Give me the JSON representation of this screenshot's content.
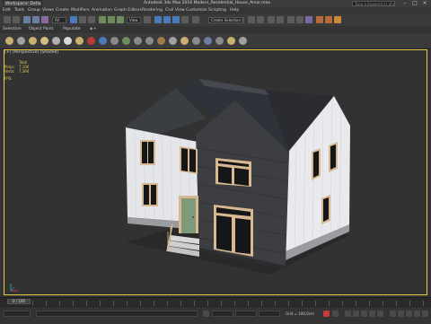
{
  "window": {
    "workspace": "Workspace: Default",
    "title": "Autodesk 3ds Max 2016     Modern_Residential_House_Amar.max",
    "search_placeholder": "Type a keyword or phrase"
  },
  "menu": [
    "Edit",
    "Tools",
    "Group",
    "Views",
    "Create",
    "Modifiers",
    "Animation",
    "Graph Editors",
    "Rendering",
    "Civil View",
    "Customize",
    "Scripting",
    "Help"
  ],
  "toolbar": {
    "selection_filter": "All",
    "view_dropdown": "View",
    "selection_set": "Create Selection Se"
  },
  "ribbon": [
    "Selection",
    "Object Paint",
    "Populate"
  ],
  "viewport": {
    "label": "[+] [Perspective] [Shaded]",
    "stats": {
      "header": "Total",
      "polys_label": "Polys:",
      "polys_value": "7,106",
      "verts_label": "Verts:",
      "verts_value": "7,390",
      "fps_label": "FPS:"
    }
  },
  "timeline": {
    "frame": "0 / 100"
  },
  "status": {
    "grid": "Grid = 100,0cm"
  },
  "colors": {
    "accent": "#e8c84a",
    "roof": "#2f3238",
    "siding": "#e6e8ec",
    "stone": "#3c3d40",
    "door": "#7e9a78"
  }
}
